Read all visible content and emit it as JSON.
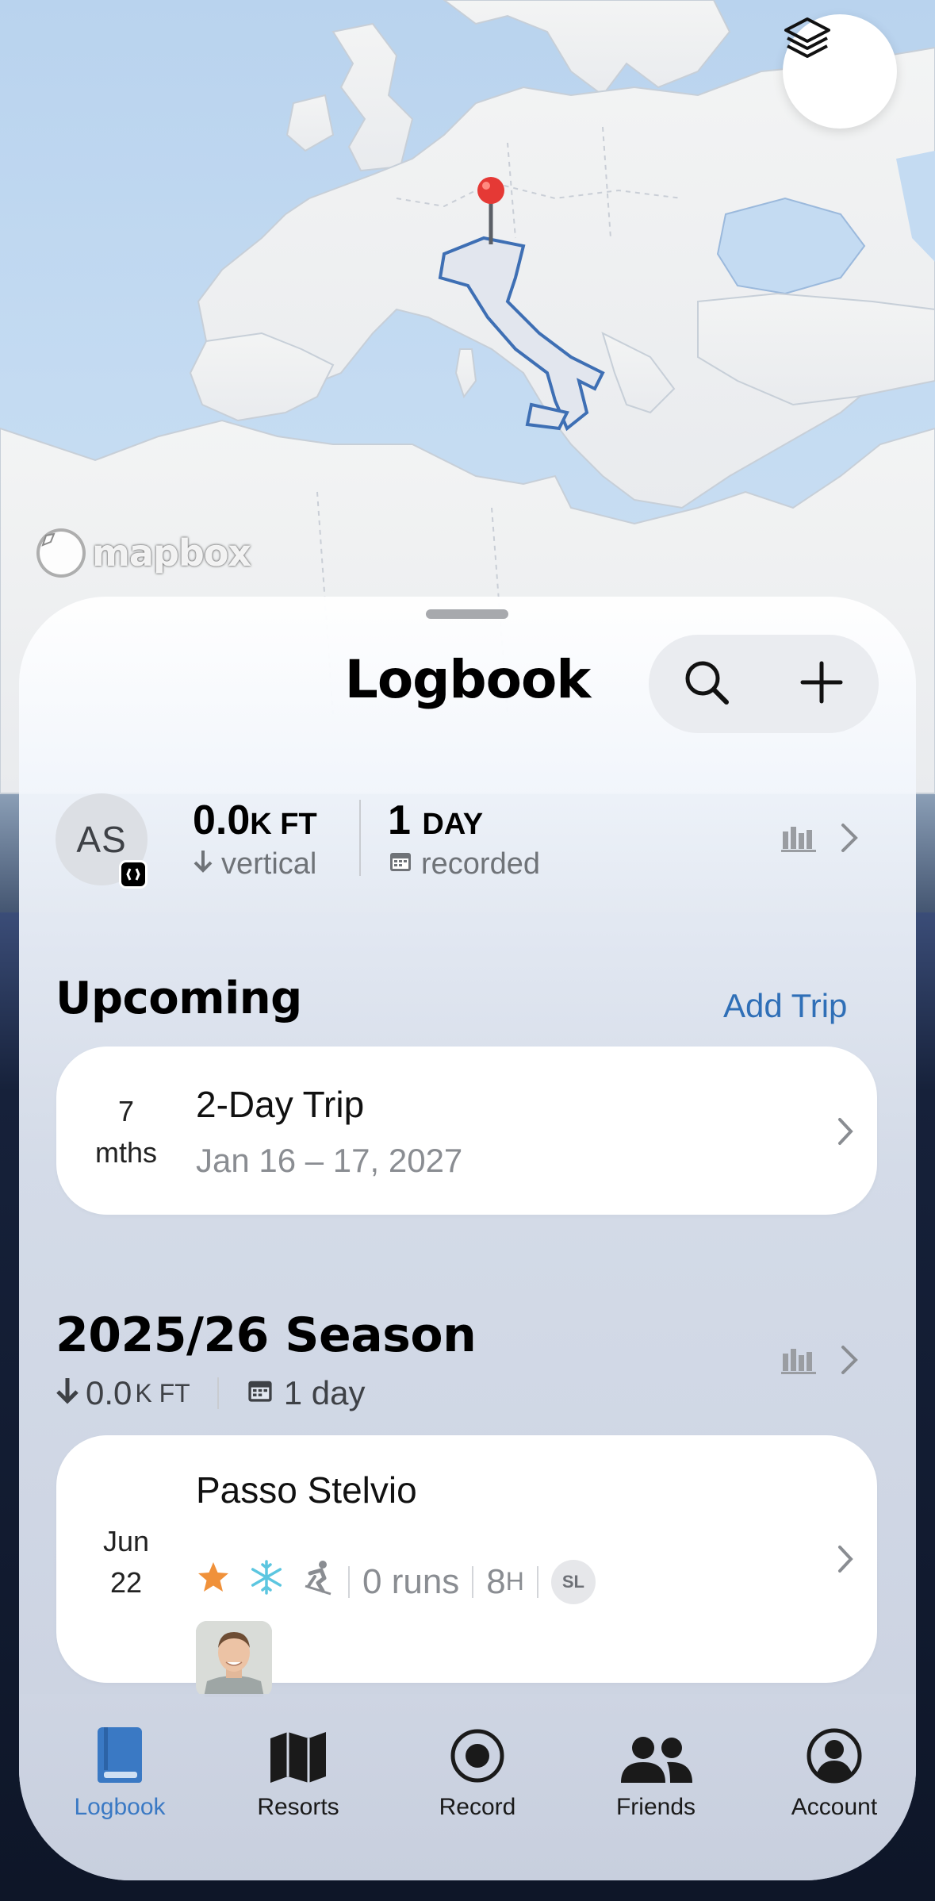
{
  "map": {
    "attribution": "mapbox",
    "layers_icon": "layers-icon",
    "pin_color": "#e53935"
  },
  "sheet": {
    "title": "Logbook",
    "search_icon": "search-icon",
    "add_icon": "plus-icon"
  },
  "profile": {
    "initials": "AS",
    "vertical_value": "0.0",
    "vertical_unit": "K FT",
    "vertical_label": "vertical",
    "days_value": "1",
    "days_unit": "DAY",
    "days_label": "recorded"
  },
  "upcoming": {
    "title": "Upcoming",
    "add_trip_label": "Add Trip",
    "trip": {
      "countdown_value": "7",
      "countdown_unit": "mths",
      "name": "2-Day Trip",
      "dates": "Jan 16 – 17, 2027"
    }
  },
  "season": {
    "title": "2025/26 Season",
    "vertical_value": "0.0",
    "vertical_unit": "K FT",
    "days_label": "1 day",
    "entry": {
      "month": "Jun",
      "day": "22",
      "resort": "Passo Stelvio",
      "runs": "0 runs",
      "hours_value": "8",
      "hours_unit": "H",
      "tag": "SL"
    }
  },
  "tabs": [
    {
      "label": "Logbook",
      "icon": "book-icon",
      "active": true
    },
    {
      "label": "Resorts",
      "icon": "map-icon",
      "active": false
    },
    {
      "label": "Record",
      "icon": "record-icon",
      "active": false
    },
    {
      "label": "Friends",
      "icon": "friends-icon",
      "active": false
    },
    {
      "label": "Account",
      "icon": "account-icon",
      "active": false
    }
  ],
  "colors": {
    "accent": "#2f6fb7",
    "active_tab": "#3a79c4",
    "star": "#f0913a",
    "snowflake": "#5cc6e0"
  }
}
